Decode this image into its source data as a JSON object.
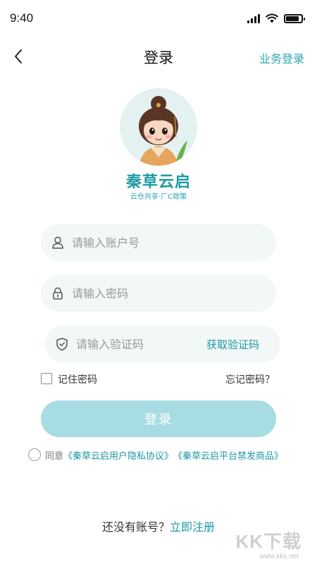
{
  "status_bar": {
    "time": "9:40",
    "signal_level": 4,
    "battery_level": 0.85
  },
  "nav": {
    "title": "登录",
    "right_link": "业务登录",
    "back_icon": "chevron-left-icon"
  },
  "brand": {
    "name": "秦草云启",
    "tagline": "云仓共享·厂C政策"
  },
  "form": {
    "account_placeholder": "请输入账户号",
    "password_placeholder": "请输入密码",
    "code_placeholder": "请输入验证码",
    "get_code_label": "获取验证码",
    "remember_label": "记住密码",
    "forgot_label": "忘记密码？",
    "login_label": "登录"
  },
  "agreement": {
    "prefix": "同意",
    "link1": "《秦草云启用户隐私协议》",
    "link2": "《秦草云启平台禁发商品》"
  },
  "register": {
    "prompt": "还没有账号？",
    "link": "立即注册"
  },
  "watermark": {
    "big": "KK下载",
    "small": "www.kkx.net"
  },
  "colors": {
    "accent": "#1e9aa2",
    "button_disabled": "#a7dde2",
    "field_bg": "#f2f7f7"
  }
}
